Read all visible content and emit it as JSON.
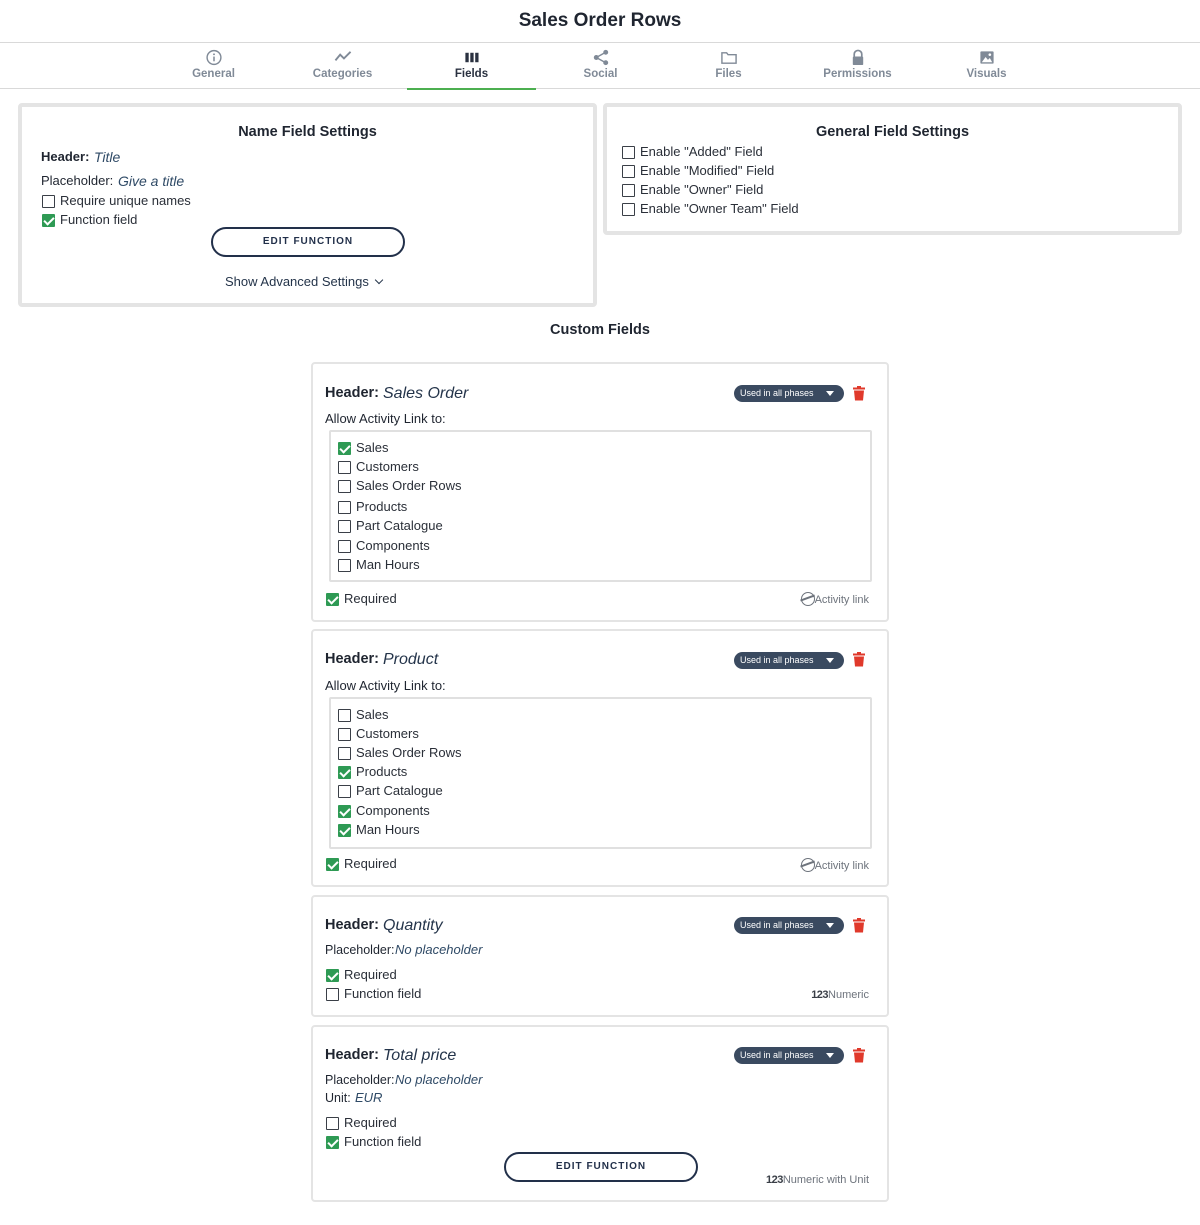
{
  "page": {
    "title": "Sales Order Rows"
  },
  "tabs": [
    {
      "label": "General",
      "icon": "info-icon"
    },
    {
      "label": "Categories",
      "icon": "chart-line-icon"
    },
    {
      "label": "Fields",
      "icon": "columns-icon",
      "active": true
    },
    {
      "label": "Social",
      "icon": "share-icon"
    },
    {
      "label": "Files",
      "icon": "folder-icon"
    },
    {
      "label": "Permissions",
      "icon": "lock-icon"
    },
    {
      "label": "Visuals",
      "icon": "image-icon"
    }
  ],
  "name_field": {
    "title": "Name Field Settings",
    "header_label": "Header:",
    "header_value": "Title",
    "placeholder_label": "Placeholder:",
    "placeholder_value": "Give a title",
    "require_unique": {
      "label": "Require unique names",
      "checked": false
    },
    "function_field": {
      "label": "Function field",
      "checked": true
    },
    "edit_function": "EDIT FUNCTION",
    "advanced": "Show Advanced Settings"
  },
  "general_field": {
    "title": "General Field Settings",
    "options": [
      {
        "label": "Enable \"Added\" Field",
        "checked": false
      },
      {
        "label": "Enable \"Modified\" Field",
        "checked": false
      },
      {
        "label": "Enable \"Owner\" Field",
        "checked": false
      },
      {
        "label": "Enable \"Owner Team\" Field",
        "checked": false
      }
    ]
  },
  "custom_fields": {
    "title": "Custom Fields",
    "phase_label": "Used in all phases",
    "header_label": "Header:",
    "placeholder_label": "Placeholder:",
    "unit_label": "Unit:",
    "allow_link_label": "Allow Activity Link to:",
    "required_label": "Required",
    "function_label": "Function field",
    "edit_function": "EDIT FUNCTION",
    "cards": [
      {
        "header": "Sales Order",
        "type": "Activity link",
        "required": true,
        "links": [
          {
            "label": "Sales",
            "checked": true
          },
          {
            "label": "Customers",
            "checked": false
          },
          {
            "label": "Sales Order Rows",
            "checked": false
          },
          {
            "label": "Products",
            "checked": false
          },
          {
            "label": "Part Catalogue",
            "checked": false
          },
          {
            "label": "Components",
            "checked": false
          },
          {
            "label": "Man Hours",
            "checked": false
          }
        ]
      },
      {
        "header": "Product",
        "type": "Activity link",
        "required": true,
        "links": [
          {
            "label": "Sales",
            "checked": false
          },
          {
            "label": "Customers",
            "checked": false
          },
          {
            "label": "Sales Order Rows",
            "checked": false
          },
          {
            "label": "Products",
            "checked": true
          },
          {
            "label": "Part Catalogue",
            "checked": false
          },
          {
            "label": "Components",
            "checked": true
          },
          {
            "label": "Man Hours",
            "checked": true
          }
        ]
      },
      {
        "header": "Quantity",
        "placeholder": "No placeholder",
        "type_prefix": "123",
        "type": "Numeric",
        "required": true,
        "function": false
      },
      {
        "header": "Total price",
        "placeholder": "No placeholder",
        "unit": "EUR",
        "type_prefix": "123",
        "type": "Numeric with Unit",
        "required": false,
        "function": true
      }
    ]
  }
}
